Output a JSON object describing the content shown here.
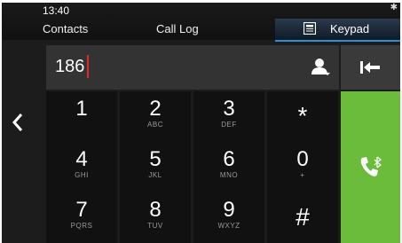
{
  "status": {
    "time": "13:40",
    "bluetooth_icon": "bluetooth-icon"
  },
  "tabs": {
    "contacts": "Contacts",
    "call_log": "Call Log",
    "keypad": "Keypad"
  },
  "dialer": {
    "number": "186"
  },
  "keypad": {
    "rows": [
      [
        {
          "digit": "1",
          "letters": ""
        },
        {
          "digit": "2",
          "letters": "ABC"
        },
        {
          "digit": "3",
          "letters": "DEF"
        },
        {
          "digit": "*",
          "letters": ""
        }
      ],
      [
        {
          "digit": "4",
          "letters": "GHI"
        },
        {
          "digit": "5",
          "letters": "JKL"
        },
        {
          "digit": "6",
          "letters": "MNO"
        },
        {
          "digit": "0",
          "letters": "+"
        }
      ],
      [
        {
          "digit": "7",
          "letters": "PQRS"
        },
        {
          "digit": "8",
          "letters": "TUV"
        },
        {
          "digit": "9",
          "letters": "WXYZ"
        },
        {
          "digit": "#",
          "letters": ""
        }
      ]
    ]
  },
  "colors": {
    "accent_blue": "#2e8fd8",
    "call_green": "#6cbc3c",
    "cursor_red": "#e0262e"
  },
  "icons": {
    "back": "chevron-left-icon",
    "contact": "contact-person-icon",
    "backspace": "backspace-icon",
    "call": "phone-bluetooth-icon",
    "keypad": "keypad-icon"
  }
}
